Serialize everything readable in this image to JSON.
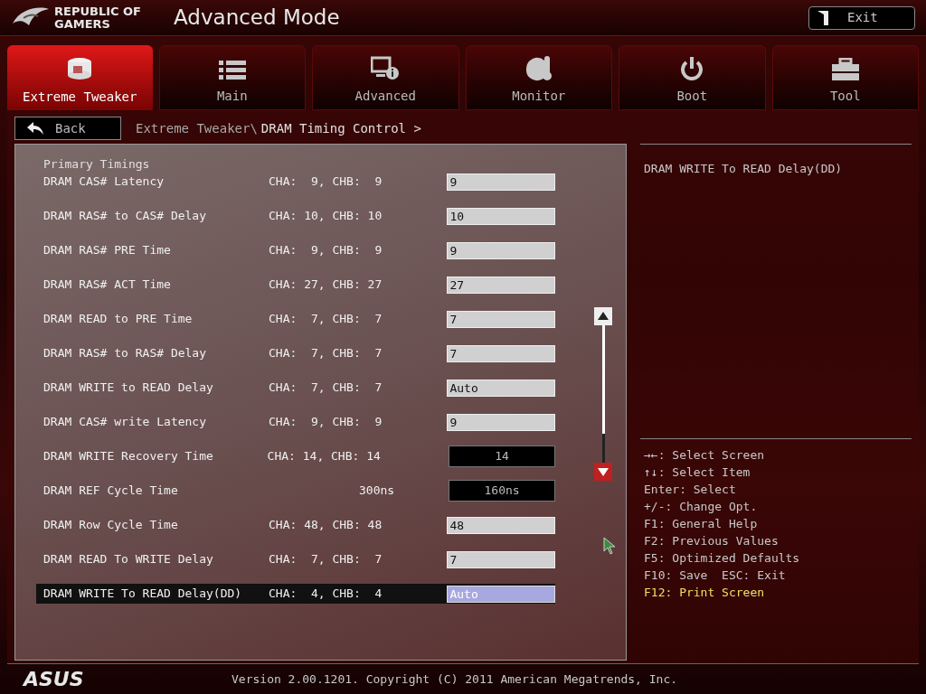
{
  "header": {
    "brand": [
      "REPUBLIC OF",
      "GAMERS"
    ],
    "title": "Advanced Mode",
    "exit_button": "Exit"
  },
  "tabs": [
    {
      "label": "Extreme Tweaker",
      "kind": "tweaker",
      "selected": true
    },
    {
      "label": "Main",
      "kind": "list",
      "selected": false
    },
    {
      "label": "Advanced",
      "kind": "advanced",
      "selected": false
    },
    {
      "label": "Monitor",
      "kind": "monitor",
      "selected": false
    },
    {
      "label": "Boot",
      "kind": "power",
      "selected": false
    },
    {
      "label": "Tool",
      "kind": "tool",
      "selected": false
    }
  ],
  "back_button": "Back",
  "breadcrumb": {
    "parent": "Extreme Tweaker\\",
    "current": "DRAM Timing Control >"
  },
  "section_heading": "Primary Timings",
  "rows": [
    {
      "name": "DRAM CAS# Latency",
      "reading": "CHA:  9, CHB:  9",
      "value": "9",
      "kind": "field",
      "selected": false
    },
    {
      "name": "DRAM RAS# to CAS# Delay",
      "reading": "CHA: 10, CHB: 10",
      "value": "10",
      "kind": "field",
      "selected": false
    },
    {
      "name": "DRAM RAS# PRE Time",
      "reading": "CHA:  9, CHB:  9",
      "value": "9",
      "kind": "field",
      "selected": false
    },
    {
      "name": "DRAM RAS# ACT Time",
      "reading": "CHA: 27, CHB: 27",
      "value": "27",
      "kind": "field",
      "selected": false
    },
    {
      "name": "DRAM READ to PRE Time",
      "reading": "CHA:  7, CHB:  7",
      "value": "7",
      "kind": "field",
      "selected": false
    },
    {
      "name": "DRAM RAS# to RAS# Delay",
      "reading": "CHA:  7, CHB:  7",
      "value": "7",
      "kind": "field",
      "selected": false
    },
    {
      "name": "DRAM WRITE to READ Delay",
      "reading": "CHA:  7, CHB:  7",
      "value": "Auto",
      "kind": "field",
      "selected": false
    },
    {
      "name": "DRAM CAS# write Latency",
      "reading": "CHA:  9, CHB:  9",
      "value": "9",
      "kind": "field",
      "selected": false
    },
    {
      "name": "DRAM WRITE Recovery Time",
      "reading": "CHA: 14, CHB: 14",
      "value": "14",
      "kind": "display",
      "selected": false
    },
    {
      "name": "DRAM REF Cycle Time",
      "reading": "300ns",
      "value": "160ns",
      "kind": "display",
      "selected": false
    },
    {
      "name": "DRAM Row Cycle Time",
      "reading": "CHA: 48, CHB: 48",
      "value": "48",
      "kind": "field",
      "selected": false
    },
    {
      "name": "DRAM READ To WRITE Delay",
      "reading": "CHA:  7, CHB:  7",
      "value": "7",
      "kind": "field",
      "selected": false
    },
    {
      "name": "DRAM WRITE To READ Delay(DD)",
      "reading": "CHA:  4, CHB:  4",
      "value": "Auto",
      "kind": "field",
      "selected": true
    }
  ],
  "help_text": "DRAM WRITE To READ Delay(DD)",
  "key_help": [
    {
      "text": "→←: Select Screen",
      "kind": "normal"
    },
    {
      "text": "↑↓: Select Item",
      "kind": "normal"
    },
    {
      "text": "Enter: Select",
      "kind": "normal"
    },
    {
      "text": "+/-: Change Opt.",
      "kind": "normal"
    },
    {
      "text": "F1: General Help",
      "kind": "normal"
    },
    {
      "text": "F2: Previous Values",
      "kind": "normal"
    },
    {
      "text": "F5: Optimized Defaults",
      "kind": "normal"
    },
    {
      "text": "F10: Save  ESC: Exit",
      "kind": "normal"
    },
    {
      "text": "F12: Print Screen",
      "kind": "highlight"
    }
  ],
  "footer": {
    "logo": "ASUS",
    "version": "Version 2.00.1201. Copyright (C) 2011 American Megatrends, Inc."
  }
}
